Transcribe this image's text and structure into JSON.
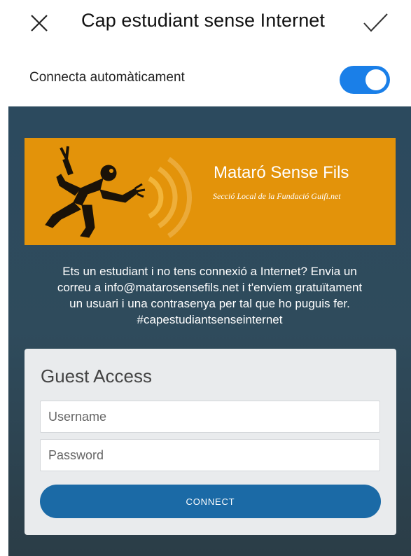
{
  "header": {
    "title": "Cap estudiant sense Internet",
    "close_icon": "close-icon",
    "confirm_icon": "checkmark-icon"
  },
  "auto_connect": {
    "label": "Connecta automàticament",
    "enabled": true,
    "accent_color": "#1a7fe8"
  },
  "portal": {
    "banner": {
      "brand": "Mataró Sense Fils",
      "subtitle": "Secció Local de la Fundació Guifi.net",
      "background_color": "#e3930a"
    },
    "description_lines": [
      "Ets un estudiant i no tens connexió a Internet? Envia un",
      "correu a info@matarosensefils.net i t'enviem gratuïtament",
      "un usuari i una contrasenya per tal que ho puguis fer.",
      "#capestudiantsenseinternet"
    ],
    "login": {
      "heading": "Guest Access",
      "username_placeholder": "Username",
      "password_placeholder": "Password",
      "connect_label": "CONNECT",
      "button_color": "#1b6aa6"
    }
  }
}
